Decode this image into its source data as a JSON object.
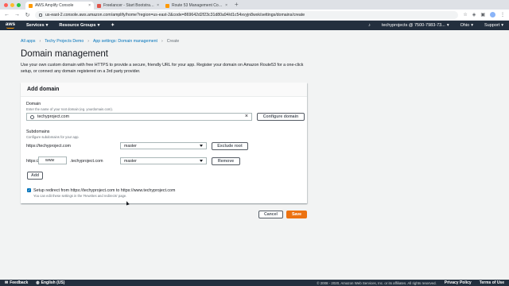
{
  "browser": {
    "tabs": [
      {
        "label": "AWS Amplify Console",
        "favicon_color": "#ff9900",
        "active": true
      },
      {
        "label": "Freelancer - Start Bootstrap Th",
        "favicon_color": "#e0544a",
        "active": false
      },
      {
        "label": "Route 53 Management Console",
        "favicon_color": "#ff9900",
        "active": false
      }
    ],
    "url": "us-east-2.console.aws.amazon.com/amplify/home?region=us-east-2&code=869642d2f23c31d80a94/d1c54xvyjn8wxk/settings/domains/create"
  },
  "aws_nav": {
    "logo": "aws",
    "services": "Services",
    "resource_groups": "Resource Groups",
    "account": "techyprojects @ 7500-7983-73...",
    "region": "Ohio",
    "support": "Support"
  },
  "breadcrumb": {
    "items": [
      "All apps",
      "Techy Projects Demo",
      "App settings: Domain management"
    ],
    "current": "Create"
  },
  "page": {
    "title": "Domain management",
    "description": "Use your own custom domain with free HTTPS to provide a secure, friendly URL for your app. Register your domain on Amazon Route53 for a one-click setup, or connect any domain registered on a 3rd party provider."
  },
  "add_domain": {
    "header": "Add domain",
    "domain_label": "Domain",
    "domain_hint": "Enter the name of your root domain (eg. yourdomain.com).",
    "domain_value": "techyproject.com",
    "configure_button": "Configure domain",
    "subdomains_label": "Subdomains",
    "subdomains_hint": "Configure subdomains for your app.",
    "rows": [
      {
        "url": "https://techyproject.com",
        "branch": "master",
        "action": "Exclude root"
      },
      {
        "prefix": "https://",
        "subdomain": "www",
        "suffix": ".techyproject.com",
        "branch": "master",
        "action": "Remove"
      }
    ],
    "add_button": "Add",
    "redirect_label": "Setup redirect from https://techyproject.com to https://www.techyproject.com",
    "redirect_hint": "You can edit these settings in the 'Rewrites and redirects' page.",
    "redirect_checked": true
  },
  "actions": {
    "cancel": "Cancel",
    "save": "Save"
  },
  "footer": {
    "feedback": "Feedback",
    "language": "English (US)",
    "copyright": "© 2008 - 2020, Amazon Web Services, Inc. or its affiliates. All rights reserved.",
    "privacy": "Privacy Policy",
    "terms": "Terms of Use"
  }
}
